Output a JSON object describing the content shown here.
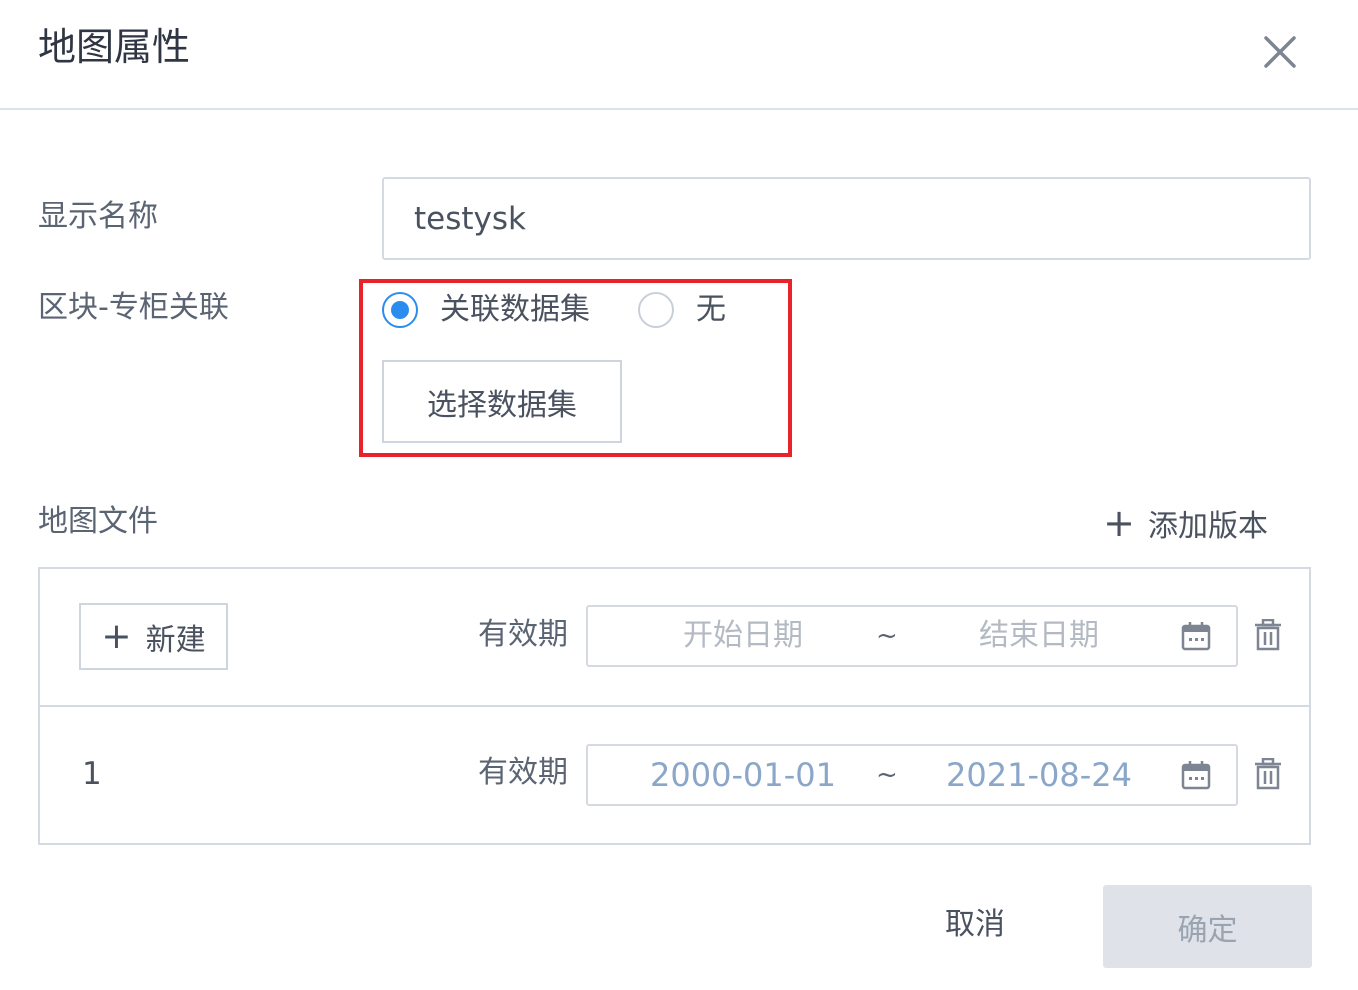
{
  "dialog": {
    "title": "地图属性",
    "close_icon": "close-icon"
  },
  "form": {
    "display_name_label": "显示名称",
    "display_name_value": "testysk",
    "block_link_label": "区块-专柜关联",
    "radio_options": [
      {
        "label": "关联数据集",
        "checked": true
      },
      {
        "label": "无",
        "checked": false
      }
    ],
    "select_dataset_button": "选择数据集",
    "highlight_color": "#e8232c"
  },
  "map_files": {
    "label": "地图文件",
    "add_version_label": "添加版本",
    "new_button_label": "新建",
    "rows": [
      {
        "version": "",
        "validity_label": "有效期",
        "start_placeholder": "开始日期",
        "end_placeholder": "结束日期",
        "start_value": "",
        "end_value": "",
        "separator": "~"
      },
      {
        "version": "1",
        "validity_label": "有效期",
        "start_placeholder": "",
        "end_placeholder": "",
        "start_value": "2000-01-01",
        "end_value": "2021-08-24",
        "separator": "~"
      }
    ]
  },
  "footer": {
    "cancel_label": "取消",
    "confirm_label": "确定"
  },
  "colors": {
    "accent": "#2b8cf0",
    "confirm_disabled_bg": "#dfe3e9"
  }
}
